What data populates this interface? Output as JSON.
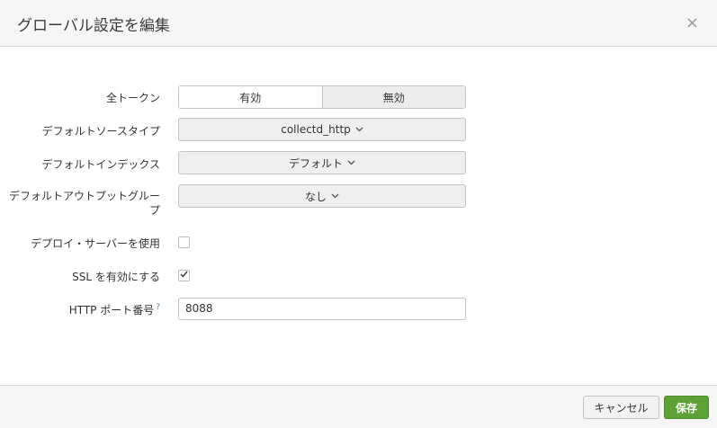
{
  "modal": {
    "title": "グローバル設定を編集",
    "close_label": "×"
  },
  "form": {
    "all_tokens": {
      "label": "全トークン",
      "options": [
        "有効",
        "無効"
      ],
      "selected": "有効"
    },
    "default_sourcetype": {
      "label": "デフォルトソースタイプ",
      "value": "collectd_http"
    },
    "default_index": {
      "label": "デフォルトインデックス",
      "value": "デフォルト"
    },
    "default_output_group": {
      "label": "デフォルトアウトプットグループ",
      "value": "なし"
    },
    "use_deployment_server": {
      "label": "デプロイ・サーバーを使用",
      "checked": false
    },
    "enable_ssl": {
      "label": "SSL を有効にする",
      "checked": true
    },
    "http_port": {
      "label": "HTTP ポート番号",
      "help_mark": "?",
      "value": "8088"
    }
  },
  "footer": {
    "cancel_label": "キャンセル",
    "save_label": "保存"
  },
  "colors": {
    "save_button": "#5ea135",
    "header_bg": "#f6f6f6"
  },
  "icons": {
    "chevron": "chevron-down-icon",
    "close": "close-icon",
    "check": "checkmark-icon"
  }
}
